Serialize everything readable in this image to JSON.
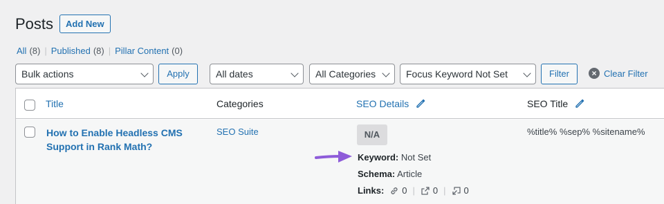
{
  "page": {
    "title": "Posts",
    "add_new": "Add New"
  },
  "views": [
    {
      "label": "All",
      "count": "(8)"
    },
    {
      "label": "Published",
      "count": "(8)"
    },
    {
      "label": "Pillar Content",
      "count": "(0)"
    }
  ],
  "filters": {
    "bulk_actions": "Bulk actions",
    "apply": "Apply",
    "dates": "All dates",
    "categories": "All Categories",
    "focus_keyword": "Focus Keyword Not Set",
    "filter": "Filter",
    "clear": "Clear Filter"
  },
  "columns": {
    "title": "Title",
    "categories": "Categories",
    "seo_details": "SEO Details",
    "seo_title": "SEO Title"
  },
  "rows": [
    {
      "title": "How to Enable Headless CMS Support in Rank Math?",
      "category": "SEO Suite",
      "score": "N/A",
      "keyword_label": "Keyword:",
      "keyword_value": "Not Set",
      "schema_label": "Schema:",
      "schema_value": "Article",
      "links_label": "Links:",
      "internal_links": "0",
      "external_links": "0",
      "incoming_links": "0",
      "seo_title": "%title% %sep% %sitename%"
    }
  ],
  "colors": {
    "accent": "#2271b1",
    "arrow": "#8e5cd9"
  },
  "icons": [
    "clear-icon",
    "pencil-icon",
    "chevron-down-icon",
    "link-icon",
    "external-link-icon",
    "incoming-link-icon",
    "arrow-pointer"
  ]
}
